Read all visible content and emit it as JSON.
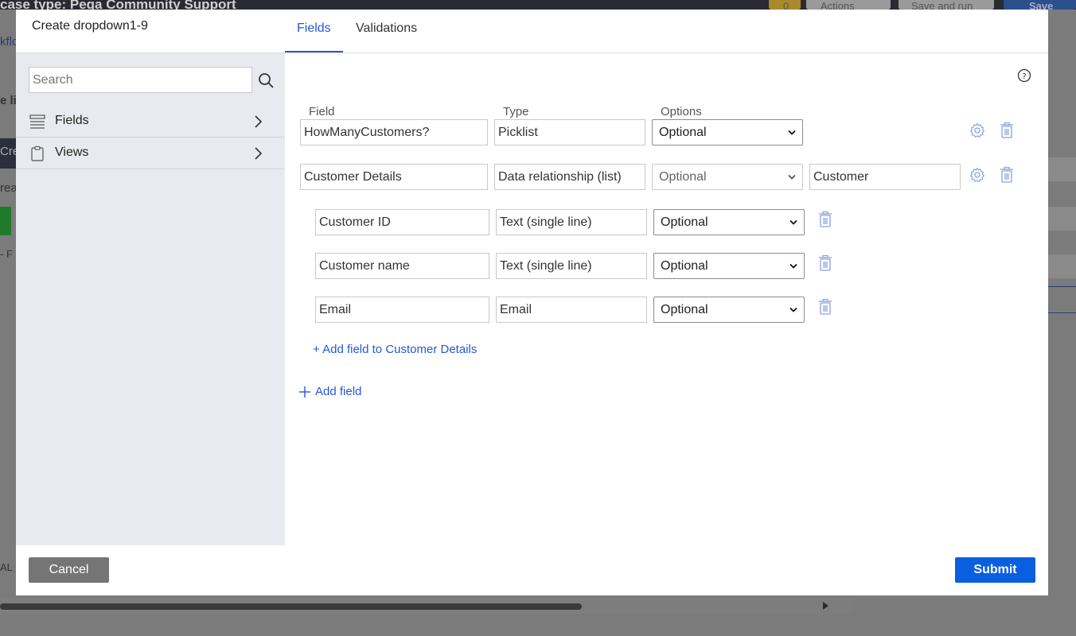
{
  "background": {
    "case_type_title": "case type: Pega Community Support",
    "badge_count": "0",
    "actions_label": "Actions",
    "save_and_run_label": "Save and run",
    "save_label": "Save",
    "left_fragments": [
      "kflo",
      "e lit",
      "Cre",
      "rea",
      "- F",
      "AL"
    ]
  },
  "modal": {
    "title": "Create dropdown1-9",
    "tabs": [
      {
        "label": "Fields",
        "active": true
      },
      {
        "label": "Validations",
        "active": false
      }
    ]
  },
  "sidebar": {
    "search_placeholder": "Search",
    "items": [
      {
        "label": "Fields",
        "icon": "list-icon"
      },
      {
        "label": "Views",
        "icon": "clipboard-icon"
      }
    ]
  },
  "columns": {
    "field": "Field",
    "type": "Type",
    "options": "Options"
  },
  "rows": [
    {
      "field": "HowManyCustomers?",
      "type": "Picklist",
      "option": "Optional"
    },
    {
      "field": "Customer Details",
      "type": "Data relationship (list)",
      "option": "Optional",
      "extra": "Customer"
    }
  ],
  "sub_rows": [
    {
      "field": "Customer ID",
      "type": "Text (single line)",
      "option": "Optional"
    },
    {
      "field": "Customer name",
      "type": "Text (single line)",
      "option": "Optional"
    },
    {
      "field": "Email",
      "type": "Email",
      "option": "Optional"
    }
  ],
  "links": {
    "add_sub_field": "+ Add field to Customer Details",
    "add_field": "Add field"
  },
  "footer": {
    "cancel_label": "Cancel",
    "submit_label": "Submit"
  },
  "colors": {
    "accent": "#2458d8",
    "submit": "#0a5fe0",
    "cancel": "#757575",
    "sidebar_bg": "#e9eaef"
  }
}
